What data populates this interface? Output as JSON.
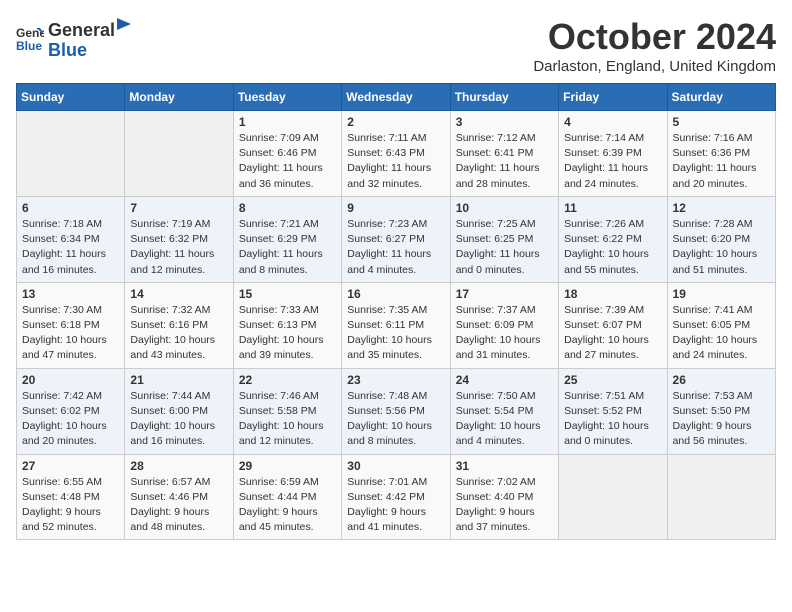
{
  "header": {
    "logo_general": "General",
    "logo_blue": "Blue",
    "title": "October 2024",
    "location": "Darlaston, England, United Kingdom"
  },
  "weekdays": [
    "Sunday",
    "Monday",
    "Tuesday",
    "Wednesday",
    "Thursday",
    "Friday",
    "Saturday"
  ],
  "weeks": [
    [
      {
        "day": "",
        "info": ""
      },
      {
        "day": "",
        "info": ""
      },
      {
        "day": "1",
        "info": "Sunrise: 7:09 AM\nSunset: 6:46 PM\nDaylight: 11 hours\nand 36 minutes."
      },
      {
        "day": "2",
        "info": "Sunrise: 7:11 AM\nSunset: 6:43 PM\nDaylight: 11 hours\nand 32 minutes."
      },
      {
        "day": "3",
        "info": "Sunrise: 7:12 AM\nSunset: 6:41 PM\nDaylight: 11 hours\nand 28 minutes."
      },
      {
        "day": "4",
        "info": "Sunrise: 7:14 AM\nSunset: 6:39 PM\nDaylight: 11 hours\nand 24 minutes."
      },
      {
        "day": "5",
        "info": "Sunrise: 7:16 AM\nSunset: 6:36 PM\nDaylight: 11 hours\nand 20 minutes."
      }
    ],
    [
      {
        "day": "6",
        "info": "Sunrise: 7:18 AM\nSunset: 6:34 PM\nDaylight: 11 hours\nand 16 minutes."
      },
      {
        "day": "7",
        "info": "Sunrise: 7:19 AM\nSunset: 6:32 PM\nDaylight: 11 hours\nand 12 minutes."
      },
      {
        "day": "8",
        "info": "Sunrise: 7:21 AM\nSunset: 6:29 PM\nDaylight: 11 hours\nand 8 minutes."
      },
      {
        "day": "9",
        "info": "Sunrise: 7:23 AM\nSunset: 6:27 PM\nDaylight: 11 hours\nand 4 minutes."
      },
      {
        "day": "10",
        "info": "Sunrise: 7:25 AM\nSunset: 6:25 PM\nDaylight: 11 hours\nand 0 minutes."
      },
      {
        "day": "11",
        "info": "Sunrise: 7:26 AM\nSunset: 6:22 PM\nDaylight: 10 hours\nand 55 minutes."
      },
      {
        "day": "12",
        "info": "Sunrise: 7:28 AM\nSunset: 6:20 PM\nDaylight: 10 hours\nand 51 minutes."
      }
    ],
    [
      {
        "day": "13",
        "info": "Sunrise: 7:30 AM\nSunset: 6:18 PM\nDaylight: 10 hours\nand 47 minutes."
      },
      {
        "day": "14",
        "info": "Sunrise: 7:32 AM\nSunset: 6:16 PM\nDaylight: 10 hours\nand 43 minutes."
      },
      {
        "day": "15",
        "info": "Sunrise: 7:33 AM\nSunset: 6:13 PM\nDaylight: 10 hours\nand 39 minutes."
      },
      {
        "day": "16",
        "info": "Sunrise: 7:35 AM\nSunset: 6:11 PM\nDaylight: 10 hours\nand 35 minutes."
      },
      {
        "day": "17",
        "info": "Sunrise: 7:37 AM\nSunset: 6:09 PM\nDaylight: 10 hours\nand 31 minutes."
      },
      {
        "day": "18",
        "info": "Sunrise: 7:39 AM\nSunset: 6:07 PM\nDaylight: 10 hours\nand 27 minutes."
      },
      {
        "day": "19",
        "info": "Sunrise: 7:41 AM\nSunset: 6:05 PM\nDaylight: 10 hours\nand 24 minutes."
      }
    ],
    [
      {
        "day": "20",
        "info": "Sunrise: 7:42 AM\nSunset: 6:02 PM\nDaylight: 10 hours\nand 20 minutes."
      },
      {
        "day": "21",
        "info": "Sunrise: 7:44 AM\nSunset: 6:00 PM\nDaylight: 10 hours\nand 16 minutes."
      },
      {
        "day": "22",
        "info": "Sunrise: 7:46 AM\nSunset: 5:58 PM\nDaylight: 10 hours\nand 12 minutes."
      },
      {
        "day": "23",
        "info": "Sunrise: 7:48 AM\nSunset: 5:56 PM\nDaylight: 10 hours\nand 8 minutes."
      },
      {
        "day": "24",
        "info": "Sunrise: 7:50 AM\nSunset: 5:54 PM\nDaylight: 10 hours\nand 4 minutes."
      },
      {
        "day": "25",
        "info": "Sunrise: 7:51 AM\nSunset: 5:52 PM\nDaylight: 10 hours\nand 0 minutes."
      },
      {
        "day": "26",
        "info": "Sunrise: 7:53 AM\nSunset: 5:50 PM\nDaylight: 9 hours\nand 56 minutes."
      }
    ],
    [
      {
        "day": "27",
        "info": "Sunrise: 6:55 AM\nSunset: 4:48 PM\nDaylight: 9 hours\nand 52 minutes."
      },
      {
        "day": "28",
        "info": "Sunrise: 6:57 AM\nSunset: 4:46 PM\nDaylight: 9 hours\nand 48 minutes."
      },
      {
        "day": "29",
        "info": "Sunrise: 6:59 AM\nSunset: 4:44 PM\nDaylight: 9 hours\nand 45 minutes."
      },
      {
        "day": "30",
        "info": "Sunrise: 7:01 AM\nSunset: 4:42 PM\nDaylight: 9 hours\nand 41 minutes."
      },
      {
        "day": "31",
        "info": "Sunrise: 7:02 AM\nSunset: 4:40 PM\nDaylight: 9 hours\nand 37 minutes."
      },
      {
        "day": "",
        "info": ""
      },
      {
        "day": "",
        "info": ""
      }
    ]
  ]
}
